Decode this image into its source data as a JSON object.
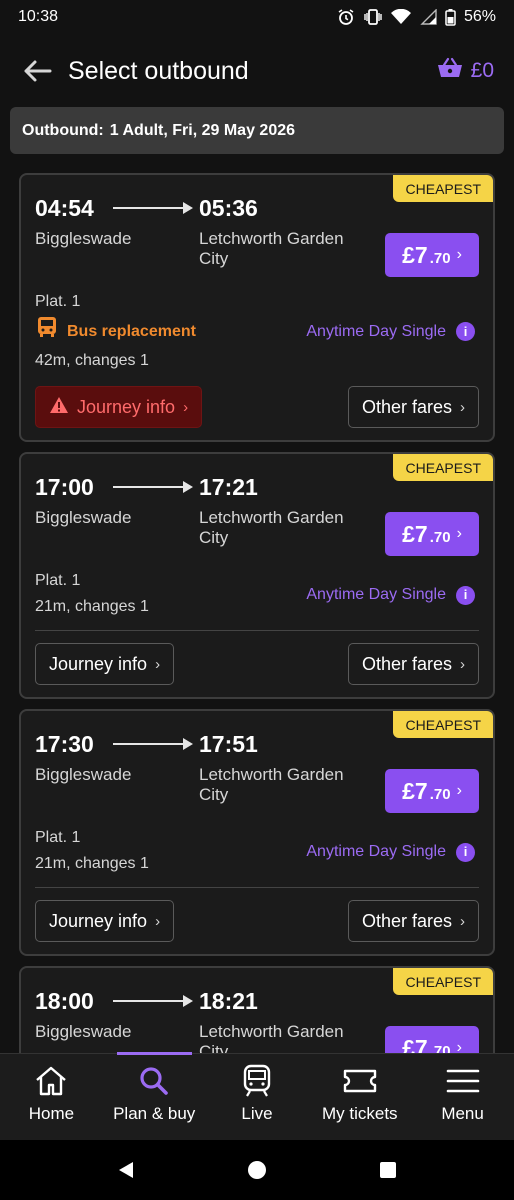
{
  "status_bar": {
    "time": "10:38",
    "battery": "56%"
  },
  "header": {
    "title": "Select outbound",
    "basket_total": "£0"
  },
  "outbound": {
    "label": "Outbound:",
    "details": "1 Adult, Fri, 29 May 2026"
  },
  "journeys": [
    {
      "badge": "CHEAPEST",
      "depart": "04:54",
      "arrive": "05:36",
      "from": "Biggleswade",
      "to": "Letchworth Garden City",
      "price_main": "£7",
      "price_pence": ".70",
      "platform": "Plat. 1",
      "alert": "Bus replacement",
      "fare_type": "Anytime Day Single",
      "duration": "42m, changes 1",
      "journey_info": "Journey info",
      "other_fares": "Other fares"
    },
    {
      "badge": "CHEAPEST",
      "depart": "17:00",
      "arrive": "17:21",
      "from": "Biggleswade",
      "to": "Letchworth Garden City",
      "price_main": "£7",
      "price_pence": ".70",
      "platform": "Plat. 1",
      "fare_type": "Anytime Day Single",
      "duration": "21m, changes 1",
      "journey_info": "Journey info",
      "other_fares": "Other fares"
    },
    {
      "badge": "CHEAPEST",
      "depart": "17:30",
      "arrive": "17:51",
      "from": "Biggleswade",
      "to": "Letchworth Garden City",
      "price_main": "£7",
      "price_pence": ".70",
      "platform": "Plat. 1",
      "fare_type": "Anytime Day Single",
      "duration": "21m, changes 1",
      "journey_info": "Journey info",
      "other_fares": "Other fares"
    },
    {
      "badge": "CHEAPEST",
      "depart": "18:00",
      "arrive": "18:21",
      "from": "Biggleswade",
      "to": "Letchworth Garden City",
      "price_main": "£7",
      "price_pence": ".70"
    }
  ],
  "bottom_nav": [
    {
      "label": "Home",
      "icon": "home-icon"
    },
    {
      "label": "Plan & buy",
      "icon": "search-icon",
      "active": true
    },
    {
      "label": "Live",
      "icon": "train-icon"
    },
    {
      "label": "My tickets",
      "icon": "ticket-icon"
    },
    {
      "label": "Menu",
      "icon": "menu-icon"
    }
  ],
  "colors": {
    "accent": "#8a4ff0",
    "badge": "#f5d447",
    "alert": "#f08a2e",
    "journey_alert_bg": "#5a0d0d"
  }
}
